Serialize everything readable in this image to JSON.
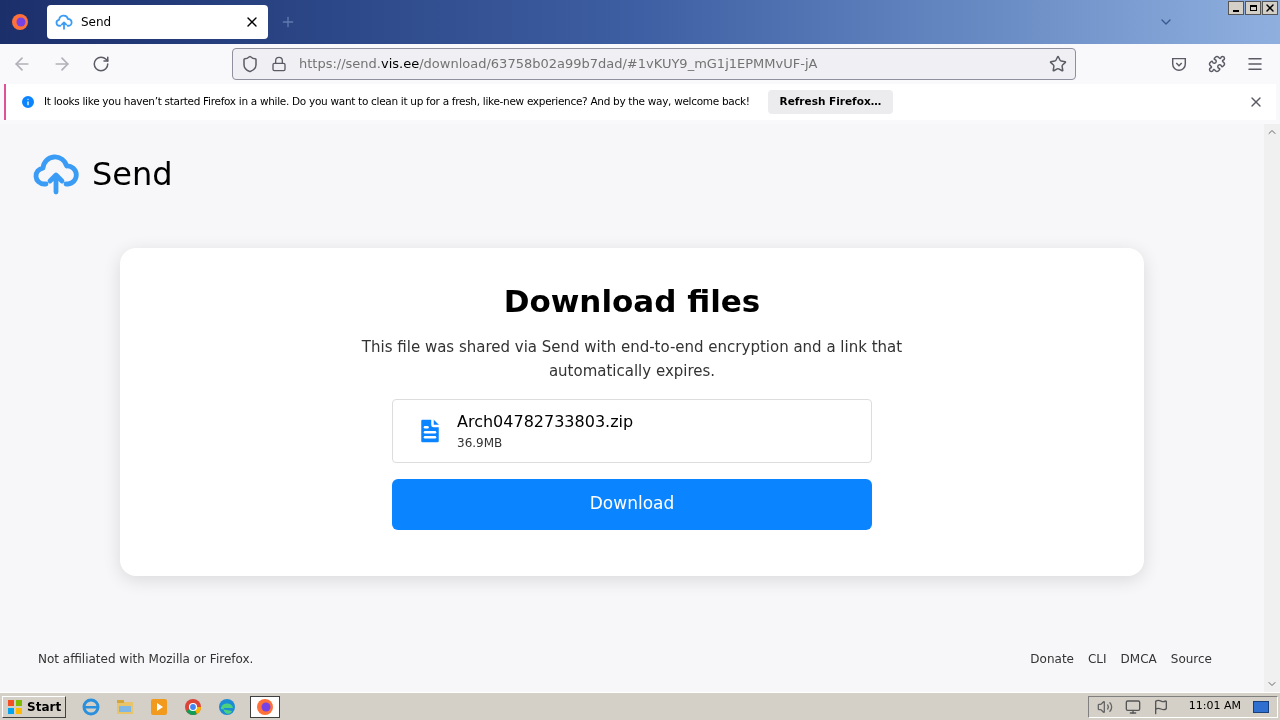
{
  "tabs": [
    {
      "title": "Send",
      "selected": true
    }
  ],
  "address_bar": {
    "url_start": "https://send.",
    "url_domain": "vis.ee",
    "url_rest": "/download/63758b02a99b7dad/#1vKUY9_mG1j1EPMMvUF-jA"
  },
  "notification": {
    "message": "It looks like you haven’t started Firefox in a while. Do you want to clean it up for a fresh, like-new experience? And by the way, welcome back!",
    "button": "Refresh Firefox…"
  },
  "page": {
    "logo": "Send",
    "heading": "Download files",
    "description": "This file was shared via Send with end-to-end encryption and a link that automatically expires.",
    "file": {
      "name": "Arch04782733803.zip",
      "size": "36.9MB"
    },
    "download_button": "Download",
    "footer_note": "Not affiliated with Mozilla or Firefox.",
    "footer_links": [
      "Donate",
      "CLI",
      "DMCA",
      "Source"
    ]
  },
  "taskbar": {
    "start": "Start",
    "apps": [
      {
        "kind": "ie",
        "selected": false
      },
      {
        "kind": "folder",
        "selected": false
      },
      {
        "kind": "media",
        "selected": false
      },
      {
        "kind": "chrome",
        "selected": false
      },
      {
        "kind": "edge",
        "selected": false
      },
      {
        "kind": "firefox",
        "selected": true
      }
    ],
    "clock": "11:01 AM"
  }
}
